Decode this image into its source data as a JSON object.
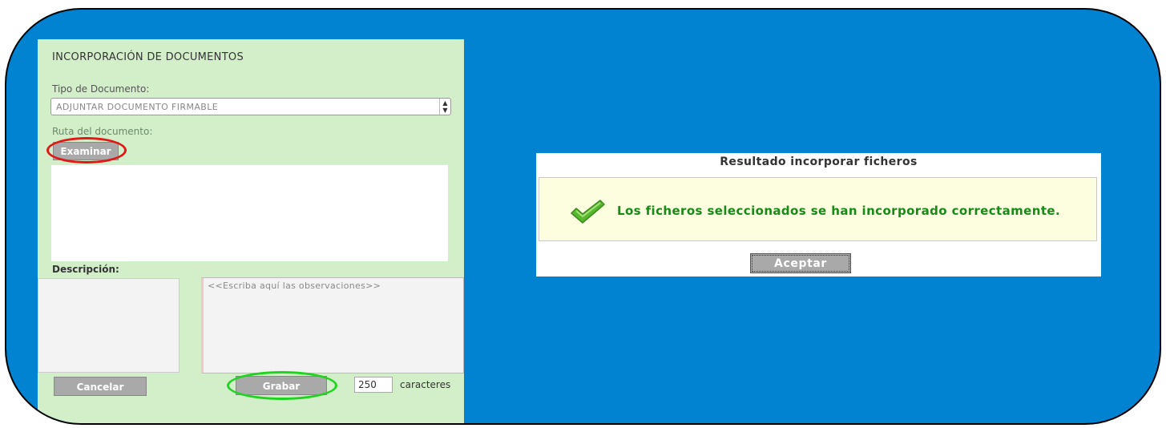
{
  "left_panel": {
    "title": "INCORPORACIÓN DE DOCUMENTOS",
    "tipo_label": "Tipo de Documento:",
    "tipo_value": "ADJUNTAR DOCUMENTO FIRMABLE",
    "ruta_label": "Ruta del documento:",
    "examinar_label": "Examinar",
    "descripcion_label": "Descripción:",
    "observaciones_placeholder": "<<Escriba aquí las observaciones>>",
    "cancel_label": "Cancelar",
    "grabar_label": "Grabar",
    "char_count": "250",
    "char_label": "caracteres"
  },
  "dialog": {
    "title": "Resultado incorporar ficheros",
    "message": "Los ficheros seleccionados se han incorporado correctamente.",
    "accept_label": "Aceptar"
  },
  "colors": {
    "background": "#0283d2",
    "panel": "#d3efca",
    "highlight_red": "#e01818",
    "highlight_green": "#1ed41e",
    "success_text": "#178a17"
  },
  "icons": [
    "chevron-up-down-icon",
    "checkmark-icon"
  ]
}
